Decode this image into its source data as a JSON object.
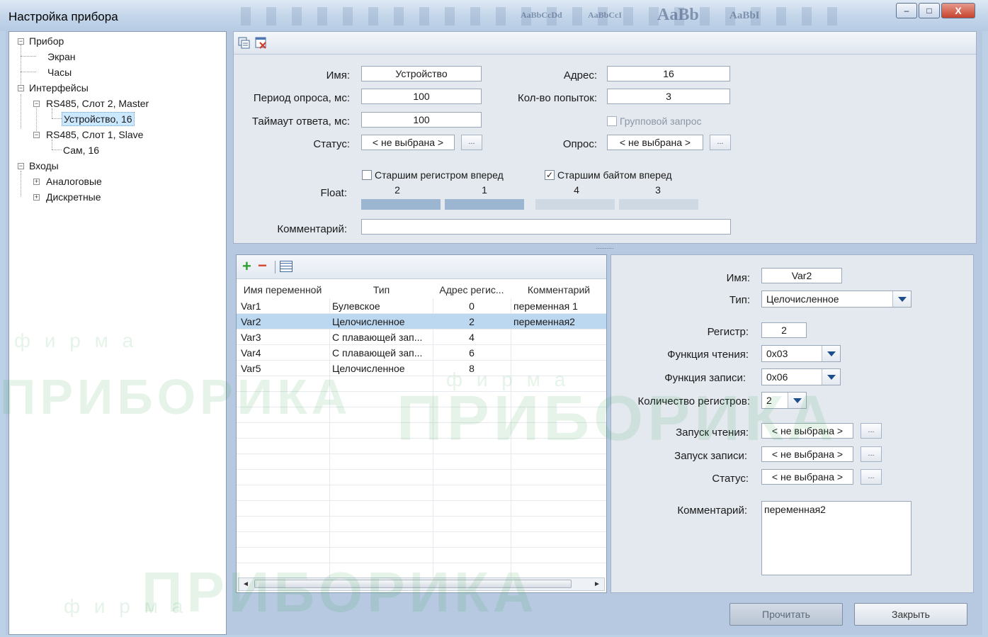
{
  "window": {
    "title": "Настройка прибора",
    "ribbon_ghost_text": [
      "AaBbCcDd",
      "AaBbCcI",
      "AaBb",
      "AaBbI"
    ],
    "controls": {
      "minimize": "–",
      "maximize": "□",
      "close": "X"
    }
  },
  "tree": {
    "nodes": [
      {
        "label": "Прибор",
        "expander": "−"
      },
      {
        "label": "Экран"
      },
      {
        "label": "Часы"
      },
      {
        "label": "Интерфейсы",
        "expander": "−"
      },
      {
        "label": "RS485, Слот 2, Master",
        "expander": "−"
      },
      {
        "label": "Устройство, 16",
        "selected": true
      },
      {
        "label": "RS485, Слот 1, Slave",
        "expander": "−"
      },
      {
        "label": "Сам, 16"
      },
      {
        "label": "Входы",
        "expander": "−"
      },
      {
        "label": "Аналоговые",
        "expander": "+"
      },
      {
        "label": "Дискретные",
        "expander": "+"
      }
    ]
  },
  "device": {
    "name_label": "Имя:",
    "name_value": "Устройство",
    "address_label": "Адрес:",
    "address_value": "16",
    "period_label": "Период опроса, мс:",
    "period_value": "100",
    "retries_label": "Кол-во попыток:",
    "retries_value": "3",
    "timeout_label": "Таймаут ответа, мс:",
    "timeout_value": "100",
    "group_label": "Групповой запрос",
    "status_label": "Статус:",
    "status_value": "< не выбрана >",
    "poll_label": "Опрос:",
    "poll_value": "< не выбрана >",
    "dots": "...",
    "float_label": "Float:",
    "reg_order_label": "Старшим регистром вперед",
    "reg_order_checked": false,
    "byte_order_label": "Старшим байтом вперед",
    "byte_order_checked": true,
    "check_mark": "✓",
    "byte_numbers": [
      "2",
      "1",
      "4",
      "3"
    ],
    "comment_label": "Комментарий:",
    "comment_value": "",
    "splitter_dots": "..........",
    "colors": {
      "byte_active": "#9cb6d2",
      "byte_inactive": "#cfd9e4"
    }
  },
  "variables": {
    "add_icon": "+",
    "remove_icon": "−",
    "columns": [
      "Имя переменной",
      "Тип",
      "Адрес регис...",
      "Комментарий"
    ],
    "rows": [
      {
        "name": "Var1",
        "type": "Булевское",
        "addr": "0",
        "comment": "переменная 1"
      },
      {
        "name": "Var2",
        "type": "Целочисленное",
        "addr": "2",
        "comment": "переменная2",
        "selected": true
      },
      {
        "name": "Var3",
        "type": "С плавающей зап...",
        "addr": "4",
        "comment": ""
      },
      {
        "name": "Var4",
        "type": "С плавающей зап...",
        "addr": "6",
        "comment": ""
      },
      {
        "name": "Var5",
        "type": "Целочисленное",
        "addr": "8",
        "comment": ""
      }
    ],
    "scroll_left": "◄",
    "scroll_right": "►"
  },
  "props": {
    "name_label": "Имя:",
    "name_value": "Var2",
    "type_label": "Тип:",
    "type_value": "Целочисленное",
    "register_label": "Регистр:",
    "register_value": "2",
    "read_fn_label": "Функция чтения:",
    "read_fn_value": "0x03",
    "write_fn_label": "Функция записи:",
    "write_fn_value": "0x06",
    "reg_count_label": "Количество регистров:",
    "reg_count_value": "2",
    "read_start_label": "Запуск чтения:",
    "read_start_value": "< не выбрана >",
    "write_start_label": "Запуск записи:",
    "write_start_value": "< не выбрана >",
    "status_label": "Статус:",
    "status_value": "< не выбрана >",
    "dots": "...",
    "comment_label": "Комментарий:",
    "comment_value": "переменная2"
  },
  "buttons": {
    "read": "Прочитать",
    "close": "Закрыть"
  },
  "watermark": {
    "brand": "ПРИБОРИКА",
    "firm": "ф и р м а"
  }
}
